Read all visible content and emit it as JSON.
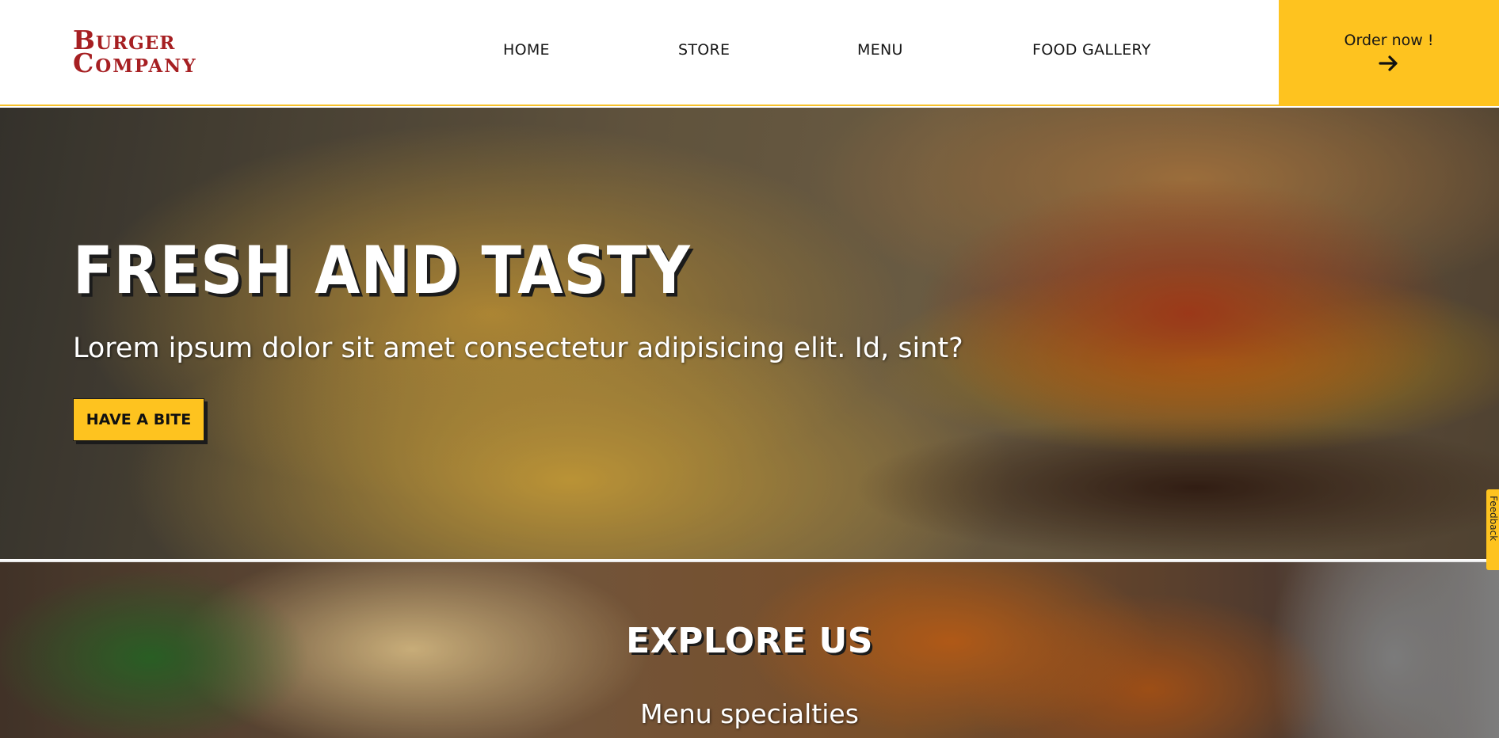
{
  "header": {
    "logo": {
      "line1": "Burger",
      "line2": "Company"
    },
    "nav": [
      "HOME",
      "STORE",
      "MENU",
      "FOOD GALLERY"
    ],
    "order": {
      "label": "Order now !",
      "icon": "arrow-right-icon"
    }
  },
  "hero": {
    "title": "FRESH AND TASTY",
    "subtitle": "Lorem ipsum dolor sit amet consectetur adipisicing elit. Id, sint?",
    "button": "HAVE A BITE"
  },
  "feedback": {
    "label": "Feedback"
  },
  "explore": {
    "title": "EXPLORE US",
    "subtitle": "Menu specialties"
  },
  "colors": {
    "accent": "#fec31f",
    "logo": "#a61f22",
    "text_dark": "#161616"
  }
}
